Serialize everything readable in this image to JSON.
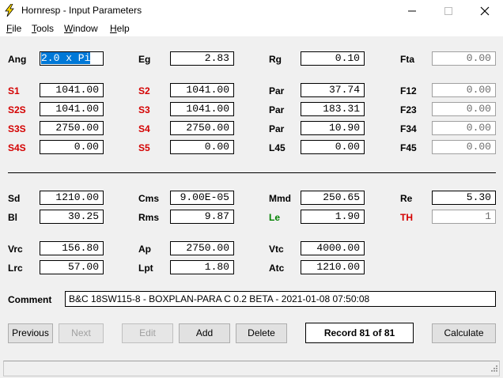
{
  "window": {
    "title": "Hornresp - Input Parameters"
  },
  "menu": [
    "File",
    "Tools",
    "Window",
    "Help"
  ],
  "fields": {
    "Ang": "2.0 x Pi",
    "Eg": "2.83",
    "Rg": "0.10",
    "Fta": "0.00",
    "S1": "1041.00",
    "S2": "1041.00",
    "Par1": "37.74",
    "F12": "0.00",
    "S2S": "1041.00",
    "S3": "1041.00",
    "Par2": "183.31",
    "F23": "0.00",
    "S3S": "2750.00",
    "S4": "2750.00",
    "Par3": "10.90",
    "F34": "0.00",
    "S4S": "0.00",
    "S5": "0.00",
    "L45": "0.00",
    "F45": "0.00",
    "Sd": "1210.00",
    "Cms": "9.00E-05",
    "Mmd": "250.65",
    "Re": "5.30",
    "Bl": "30.25",
    "Rms": "9.87",
    "Le": "1.90",
    "TH": "1",
    "Vrc": "156.80",
    "Ap": "2750.00",
    "Vtc": "4000.00",
    "Lrc": "57.00",
    "Lpt": "1.80",
    "Atc": "1210.00"
  },
  "labels": {
    "Ang": "Ang",
    "Eg": "Eg",
    "Rg": "Rg",
    "Fta": "Fta",
    "S1": "S1",
    "S2": "S2",
    "Par": "Par",
    "F12": "F12",
    "S2S": "S2S",
    "S3": "S3",
    "F23": "F23",
    "S3S": "S3S",
    "S4": "S4",
    "F34": "F34",
    "S4S": "S4S",
    "S5": "S5",
    "L45": "L45",
    "F45": "F45",
    "Sd": "Sd",
    "Cms": "Cms",
    "Mmd": "Mmd",
    "Re": "Re",
    "Bl": "Bl",
    "Rms": "Rms",
    "Le": "Le",
    "TH": "TH",
    "Vrc": "Vrc",
    "Ap": "Ap",
    "Vtc": "Vtc",
    "Lrc": "Lrc",
    "Lpt": "Lpt",
    "Atc": "Atc",
    "Comment": "Comment"
  },
  "comment": "B&C 18SW115-8 - BOXPLAN-PARA C 0.2 BETA - 2021-01-08 07:50:08",
  "buttons": {
    "previous": "Previous",
    "next": "Next",
    "edit": "Edit",
    "add": "Add",
    "delete": "Delete",
    "calculate": "Calculate"
  },
  "record": "Record 81 of 81",
  "colors": {
    "label_red": "#d40000",
    "label_green": "#008000",
    "selection": "#0078d7"
  }
}
